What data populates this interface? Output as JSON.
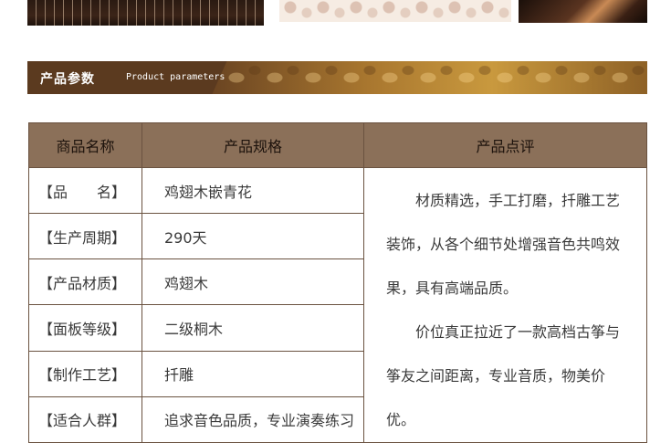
{
  "section": {
    "title_cn": "产品参数",
    "title_en": "Product parameters"
  },
  "table": {
    "headers": [
      "商品名称",
      "产品规格",
      "产品点评"
    ],
    "rows": [
      {
        "name": "【品　　名】",
        "spec": "鸡翅木嵌青花"
      },
      {
        "name": "【生产周期】",
        "spec": "290天"
      },
      {
        "name": "【产品材质】",
        "spec": "鸡翅木"
      },
      {
        "name": "【面板等级】",
        "spec": "二级桐木"
      },
      {
        "name": "【制作工艺】",
        "spec": "扦雕"
      },
      {
        "name": "【适合人群】",
        "spec": "追求音色品质，专业演奏练习"
      }
    ],
    "review": [
      "材质精选，手工打磨，扦雕工艺装饰，从各个细节处增强音色共鸣效果，具有高端品质。",
      "价位真正拉近了一款高档古筝与筝友之间距离，专业音质，物美价优。"
    ]
  }
}
